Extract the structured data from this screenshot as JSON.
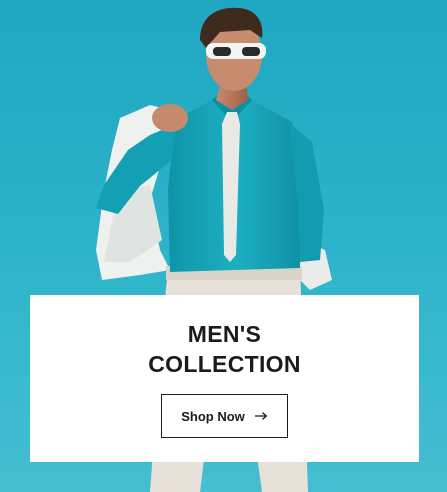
{
  "hero": {
    "image_subject": "man-in-teal-shirt-white-tie-sunglasses",
    "background_color": "#27aec4",
    "shirt_color": "#1aa5b5"
  },
  "promo": {
    "title_line1": "MEN'S",
    "title_line2": "COLLECTION",
    "button_label": "Shop Now",
    "button_icon": "arrow-right-icon"
  }
}
